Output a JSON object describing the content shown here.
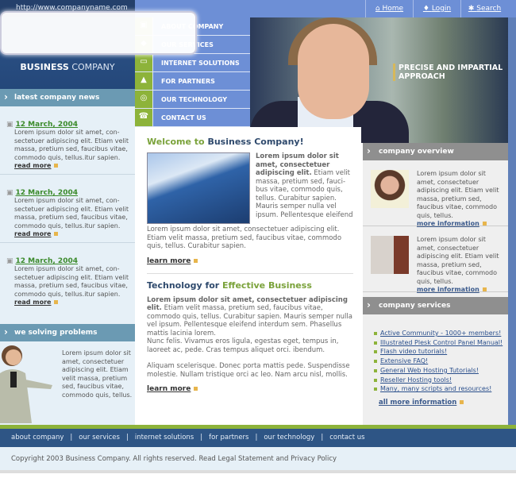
{
  "header": {
    "url": "http://www.companyname.com",
    "logo_bold": "BUSINESS",
    "logo_rest": " COMPANY",
    "top_links": [
      {
        "icon": "home-icon",
        "label": "Home"
      },
      {
        "icon": "login-icon",
        "label": "Login"
      },
      {
        "icon": "search-icon",
        "label": "Search"
      }
    ],
    "hero_text_1": "PRECISE AND IMPARTIAL",
    "hero_text_2": "APPROACH"
  },
  "nav": [
    {
      "icon": "building-icon",
      "glyph": "▣",
      "label": "ABOUT COMPANY"
    },
    {
      "icon": "services-icon",
      "glyph": "◆",
      "label": "OUR SERVICES"
    },
    {
      "icon": "computer-icon",
      "glyph": "▭",
      "label": "INTERNET SOLUTIONS"
    },
    {
      "icon": "person-icon",
      "glyph": "▲",
      "label": "FOR PARTNERS"
    },
    {
      "icon": "gear-icon",
      "glyph": "◎",
      "label": "OUR TECHNOLOGY"
    },
    {
      "icon": "phone-icon",
      "glyph": "☎",
      "label": "CONTACT US"
    }
  ],
  "left": {
    "news_title": "latest company news",
    "news": [
      {
        "date": "12 March, 2004",
        "text": "Lorem ipsum dolor sit amet, con-sectetuer adipiscing elit. Etiam velit massa, pretium sed, faucibus vitae, commodo quis, tellus.itur sapien.",
        "more": "read more"
      },
      {
        "date": "12 March, 2004",
        "text": "Lorem ipsum dolor sit amet, con-sectetuer adipiscing elit. Etiam velit massa, pretium sed, faucibus vitae, commodo quis, tellus.itur sapien.",
        "more": "read more"
      },
      {
        "date": "12 March, 2004",
        "text": "Lorem ipsum dolor sit amet, con-sectetuer adipiscing elit. Etiam velit massa, pretium sed, faucibus vitae, commodo quis, tellus.itur sapien.",
        "more": "read more"
      }
    ],
    "solve_title": "we solving problems",
    "solve_text": "Lorem ipsum dolor sit amet, consectetuer adipiscing elit. Etiam velit massa, pretium sed, faucibus vitae, commodo quis, tellus."
  },
  "main": {
    "welcome_a": "Welcome to ",
    "welcome_b": "Business Company!",
    "intro_bold": "Lorem ipsum dolor sit amet, consectetuer adipiscing elit.",
    "intro": " Etiam velit massa, pretium sed, fauci-bus vitae, commodo quis, tellus. Curabitur sapien. Mauris semper nulla vel ipsum. Pellentesque eleifend",
    "intro2": "Lorem ipsum dolor sit amet, consectetuer adipiscing elit. Etiam velit massa, pretium sed, faucibus vitae, commodo quis, tellus. Curabitur sapien.",
    "learn_more": "learn more",
    "tech_a": "Technology for ",
    "tech_b": "Effective Business",
    "tech_bold": "Lorem ipsum dolor sit amet, consectetuer adipiscing elit.",
    "tech_p1": " Etiam velit massa, pretium sed, faucibus vitae, commodo quis, tellus. Curabitur sapien. Mauris semper nulla vel ipsum. Pellentesque eleifend interdum sem. Phasellus mattis lacinia lorem.",
    "tech_p2": "Nunc felis. Vivamus eros ligula, egestas eget, tempus in, laoreet ac, pede. Cras tempus aliquet orci. ibendum.",
    "tech_p3": "Aliquam scelerisque. Donec porta mattis pede. Suspendisse molestie. Nullam tristique orci ac leo. Nam arcu nisl, mollis.",
    "learn_more2": "learn more"
  },
  "right": {
    "overview_title": "company overview",
    "overview": [
      {
        "text": "Lorem ipsum dolor sit amet, consectetuer adipiscing elit. Etiam velit massa, pretium sed, faucibus vitae, commodo quis, tellus.",
        "more": "more information"
      },
      {
        "text": "Lorem ipsum dolor sit amet, consectetuer adipiscing elit. Etiam velit massa, pretium sed, faucibus vitae, commodo quis, tellus.",
        "more": "more information"
      }
    ],
    "services_title": "company services",
    "services": [
      "Active Community - 1000+ members!",
      "Illustrated Plesk Control Panel Manual!",
      "Flash video tutorials!",
      "Extensive FAQ!",
      "General Web Hosting Tutorials!",
      "Reseller Hosting tools!",
      "Many, many scripts and resources!"
    ],
    "all_more": "all more information"
  },
  "footer": {
    "links": [
      "about company",
      "our services",
      "internet solutions",
      "for partners",
      "our technology",
      "contact us"
    ],
    "separator": "|",
    "copyright": "Copyright 2003 Business Company. All rights reserved. Read Legal Statement and Privacy Policy"
  },
  "colors": {
    "accent_green": "#8db33a",
    "nav_blue": "#6d8fd6",
    "dark_blue": "#2e5585"
  }
}
